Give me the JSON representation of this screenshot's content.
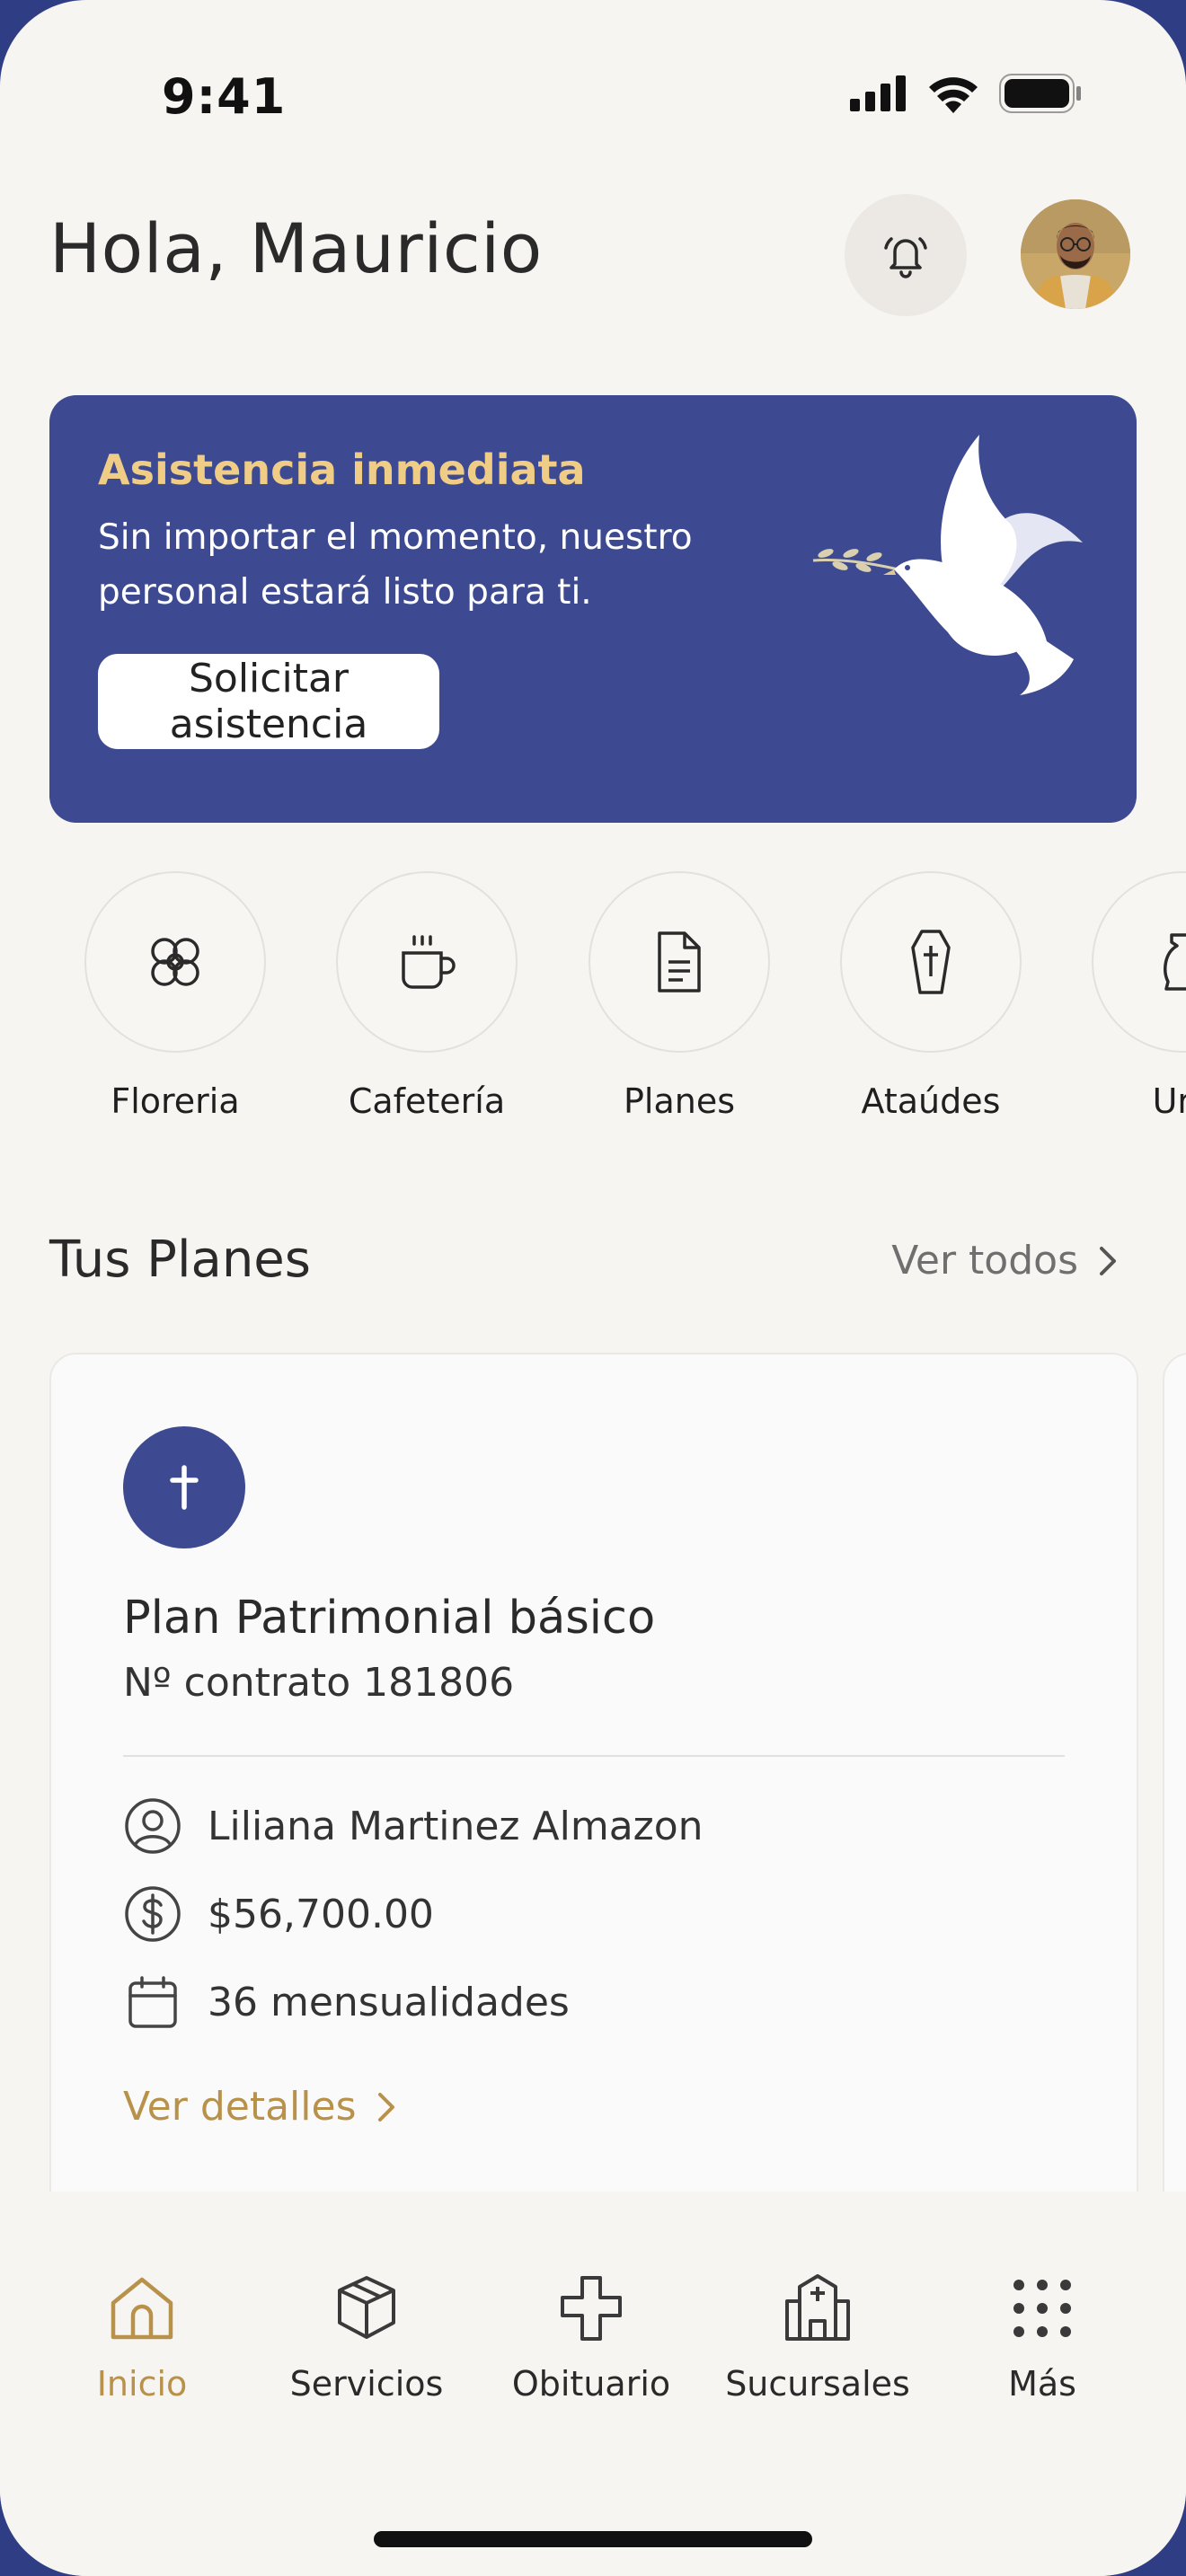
{
  "status_bar": {
    "time": "9:41"
  },
  "header": {
    "greeting": "Hola, Mauricio"
  },
  "banner": {
    "title": "Asistencia inmediata",
    "text": "Sin importar el momento, nuestro personal estará listo para ti.",
    "button_label": "Solicitar asistencia"
  },
  "categories": [
    {
      "label": "Floreria",
      "icon": "flower-icon"
    },
    {
      "label": "Cafetería",
      "icon": "coffee-cup-icon"
    },
    {
      "label": "Planes",
      "icon": "document-icon"
    },
    {
      "label": "Ataúdes",
      "icon": "coffin-icon"
    },
    {
      "label": "Urn",
      "icon": "urn-icon"
    }
  ],
  "plans_section": {
    "title": "Tus Planes",
    "see_all": "Ver todos"
  },
  "plan_card": {
    "name": "Plan Patrimonial básico",
    "contract": "Nº contrato 181806",
    "holder": "Liliana Martinez Almazon",
    "amount": "$56,700.00",
    "installments": "36 mensualidades",
    "details_link": "Ver detalles"
  },
  "bottom_nav": [
    {
      "label": "Inicio",
      "icon": "home-icon",
      "active": true
    },
    {
      "label": "Servicios",
      "icon": "box-icon",
      "active": false
    },
    {
      "label": "Obituario",
      "icon": "cross-outline-icon",
      "active": false
    },
    {
      "label": "Sucursales",
      "icon": "building-icon",
      "active": false
    },
    {
      "label": "Más",
      "icon": "grid-dots-icon",
      "active": false
    }
  ],
  "colors": {
    "primary": "#3d4a91",
    "accent": "#b8914b",
    "banner_title": "#f0cd86",
    "background": "#f6f5f2"
  }
}
